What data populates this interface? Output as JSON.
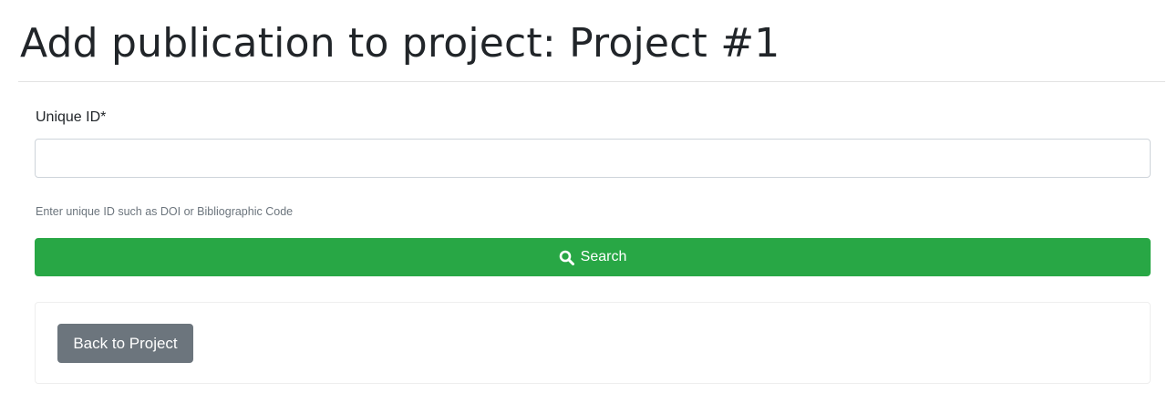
{
  "page": {
    "title": "Add publication to project: Project #1"
  },
  "form": {
    "unique_id_label": "Unique ID*",
    "unique_id_value": "",
    "unique_id_placeholder": "",
    "help_text": "Enter unique ID such as DOI or Bibliographic Code",
    "search_label": "Search",
    "search_icon": "magnifier-icon",
    "search_color": "#28a745"
  },
  "footer": {
    "back_label": "Back to Project",
    "back_color": "#6c757d"
  }
}
